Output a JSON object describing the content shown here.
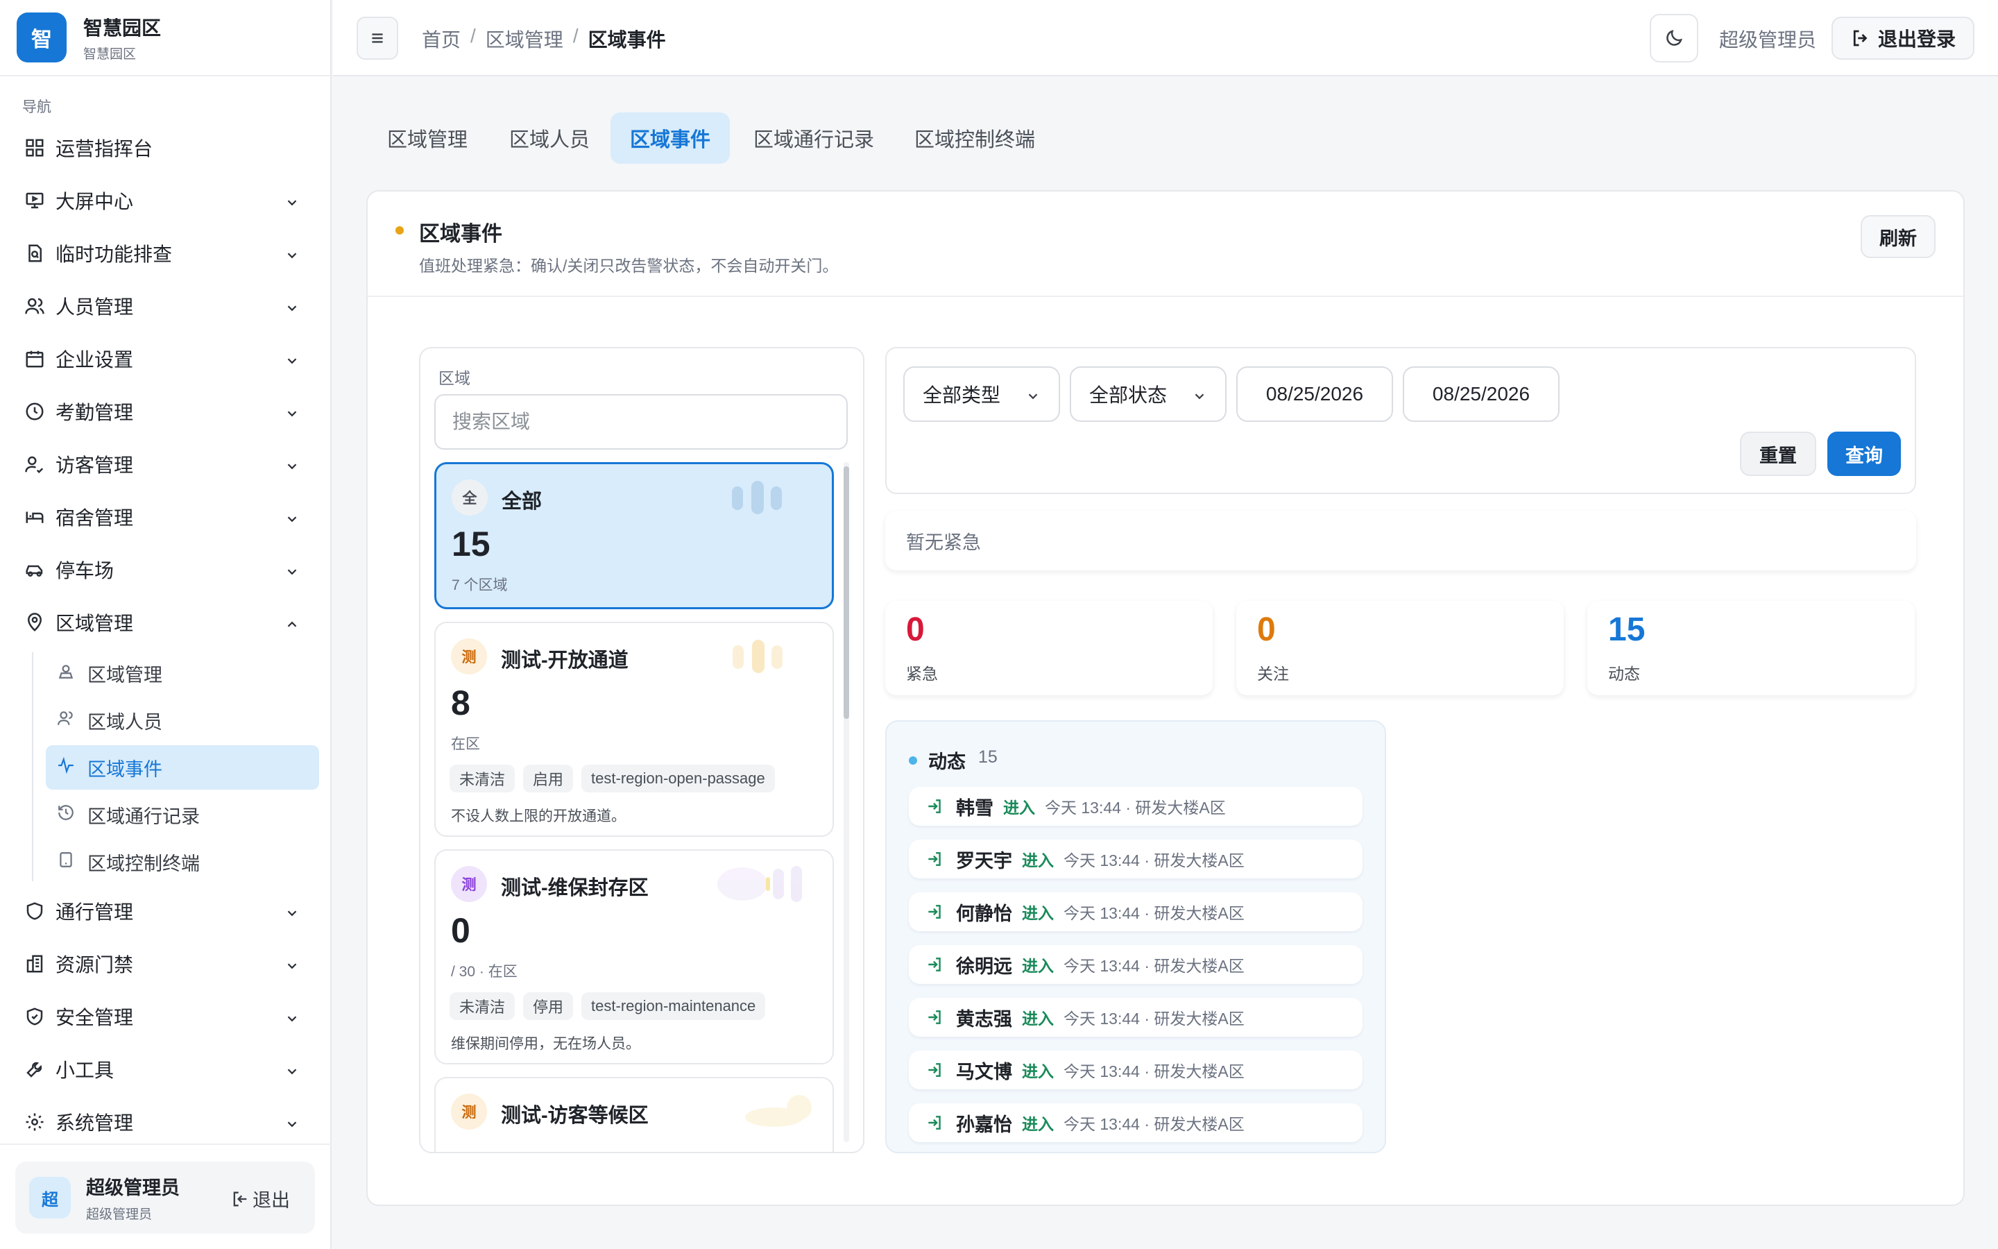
{
  "brand": {
    "logo": "智",
    "title": "智慧园区",
    "subtitle": "智慧园区"
  },
  "nav": {
    "section": "导航",
    "items": [
      {
        "label": "运营指挥台",
        "icon": "dashboard-icon"
      },
      {
        "label": "大屏中心",
        "icon": "monitor-icon"
      },
      {
        "label": "临时功能排查",
        "icon": "file-search-icon"
      },
      {
        "label": "人员管理",
        "icon": "users-icon"
      },
      {
        "label": "企业设置",
        "icon": "calendar-icon"
      },
      {
        "label": "考勤管理",
        "icon": "clock-icon"
      },
      {
        "label": "访客管理",
        "icon": "user-check-icon"
      },
      {
        "label": "宿舍管理",
        "icon": "bed-icon"
      },
      {
        "label": "停车场",
        "icon": "car-icon"
      },
      {
        "label": "区域管理",
        "icon": "map-pin-icon"
      },
      {
        "label": "通行管理",
        "icon": "shield-icon"
      },
      {
        "label": "资源门禁",
        "icon": "building-icon"
      },
      {
        "label": "安全管理",
        "icon": "shield-check-icon"
      },
      {
        "label": "小工具",
        "icon": "wrench-icon"
      },
      {
        "label": "系统管理",
        "icon": "gear-icon"
      }
    ],
    "sub_items": [
      {
        "label": "区域管理",
        "icon": "user-pin-icon"
      },
      {
        "label": "区域人员",
        "icon": "users-icon"
      },
      {
        "label": "区域事件",
        "icon": "activity-icon"
      },
      {
        "label": "区域通行记录",
        "icon": "history-icon"
      },
      {
        "label": "区域控制终端",
        "icon": "tablet-icon"
      }
    ]
  },
  "footer": {
    "avatar": "超",
    "name": "超级管理员",
    "role": "超级管理员",
    "logout": "退出"
  },
  "header": {
    "breadcrumb": [
      "首页",
      "区域管理",
      "区域事件"
    ],
    "user": "超级管理员",
    "logout": "退出登录"
  },
  "tabs": [
    "区域管理",
    "区域人员",
    "区域事件",
    "区域通行记录",
    "区域控制终端"
  ],
  "panel": {
    "title": "区域事件",
    "subtitle": "值班处理紧急：确认/关闭只改告警状态，不会自动开关门。",
    "refresh": "刷新"
  },
  "regions": {
    "label": "区域",
    "search_placeholder": "搜索区域",
    "cards": [
      {
        "badge": "全",
        "name": "全部",
        "count": "15",
        "meta": "7 个区域"
      },
      {
        "badge": "测",
        "name": "测试-开放通道",
        "count": "8",
        "meta": "在区",
        "chips": [
          "未清洁",
          "启用",
          "test-region-open-passage"
        ],
        "desc": "不设人数上限的开放通道。"
      },
      {
        "badge": "测",
        "name": "测试-维保封存区",
        "count": "0",
        "meta": "/ 30 · 在区",
        "chips": [
          "未清洁",
          "停用",
          "test-region-maintenance"
        ],
        "desc": "维保期间停用，无在场人员。"
      },
      {
        "badge": "测",
        "name": "测试-访客等候区"
      }
    ]
  },
  "filters": {
    "type": "全部类型",
    "status": "全部状态",
    "date_from": "08/25/2026",
    "date_to": "08/25/2026",
    "reset": "重置",
    "query": "查询"
  },
  "empty_text": "暂无紧急",
  "stats": [
    {
      "value": "0",
      "label": "紧急",
      "color": "#d8183a"
    },
    {
      "value": "0",
      "label": "关注",
      "color": "#de7a0c"
    },
    {
      "value": "15",
      "label": "动态",
      "color": "#1677d6"
    }
  ],
  "feed": {
    "title": "动态",
    "count": "15",
    "rows": [
      {
        "name": "韩雪",
        "action": "进入",
        "info": "今天 13:44 · 研发大楼A区"
      },
      {
        "name": "罗天宇",
        "action": "进入",
        "info": "今天 13:44 · 研发大楼A区"
      },
      {
        "name": "何静怡",
        "action": "进入",
        "info": "今天 13:44 · 研发大楼A区"
      },
      {
        "name": "徐明远",
        "action": "进入",
        "info": "今天 13:44 · 研发大楼A区"
      },
      {
        "name": "黄志强",
        "action": "进入",
        "info": "今天 13:44 · 研发大楼A区"
      },
      {
        "name": "马文博",
        "action": "进入",
        "info": "今天 13:44 · 研发大楼A区"
      },
      {
        "name": "孙嘉怡",
        "action": "进入",
        "info": "今天 13:44 · 研发大楼A区"
      }
    ]
  }
}
